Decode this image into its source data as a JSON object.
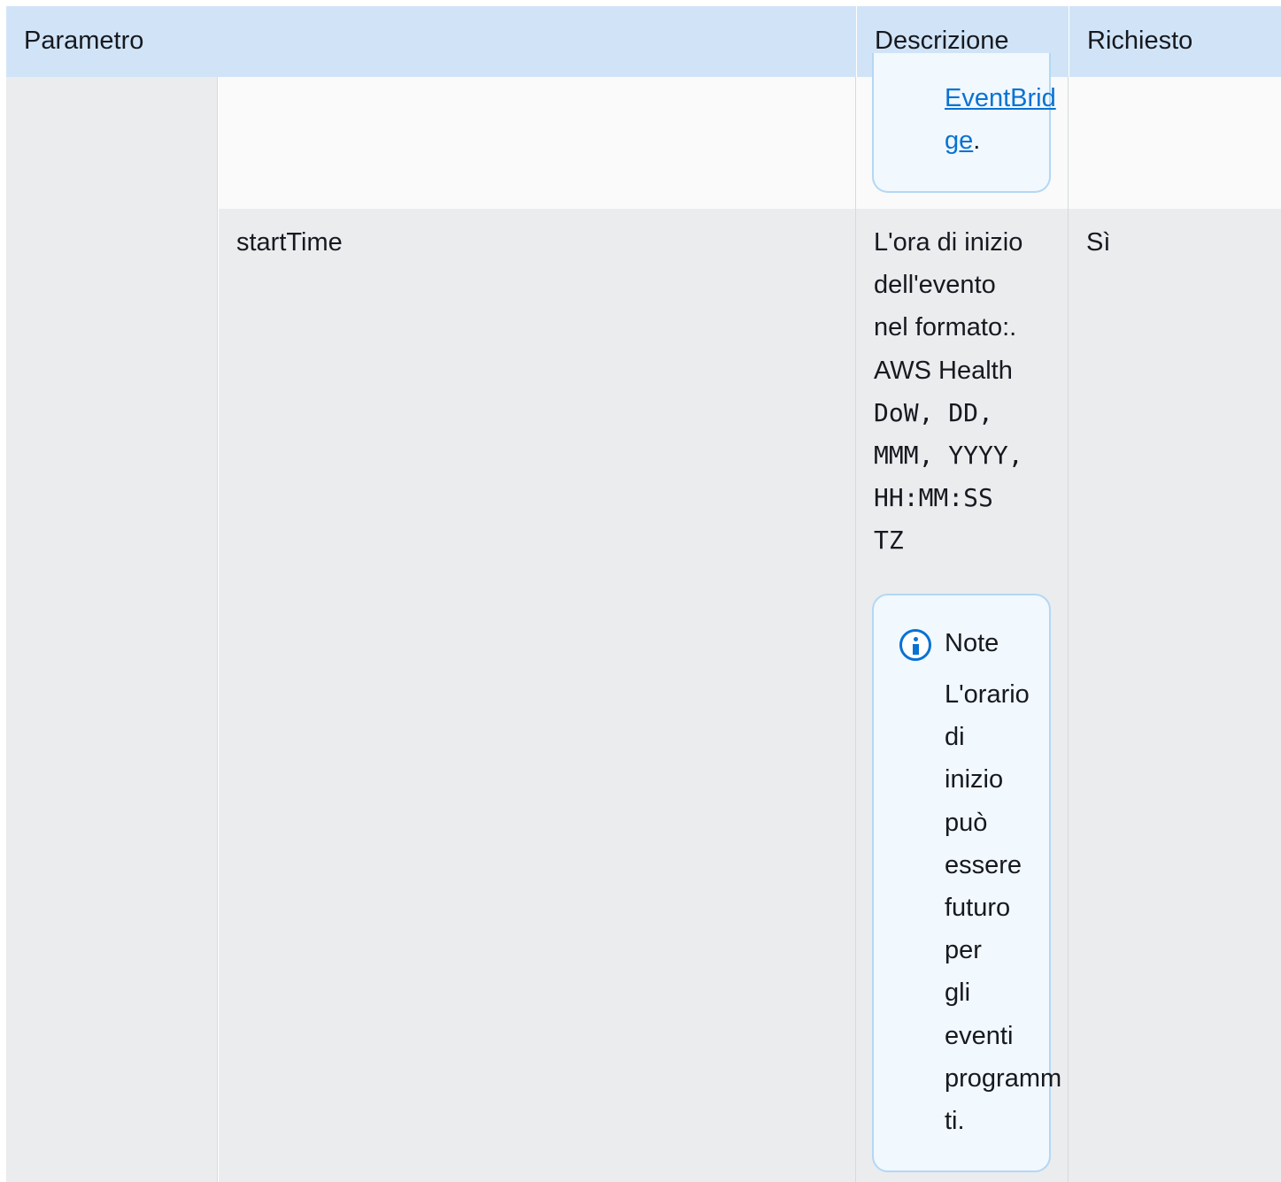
{
  "header": {
    "col_parameter": "Parametro",
    "col_description": "Descrizione",
    "col_required": "Richiesto"
  },
  "row_prev": {
    "note_link_line1": "EventBrid",
    "note_link_line2": "ge",
    "note_link_suffix": "."
  },
  "row_starttime": {
    "parameter": "startTime",
    "description_lines": [
      "L'ora di inizio",
      "dell'evento",
      "nel formato:.",
      "AWS Health"
    ],
    "format_lines": [
      "DoW, DD,",
      "MMM, YYYY,",
      "HH:MM:SS",
      "TZ"
    ],
    "required": "Sì",
    "note": {
      "title": "Note",
      "lines": [
        "L'orario",
        "di",
        "inizio",
        "può",
        "essere",
        "futuro",
        "per",
        "gli",
        "eventi",
        "programm",
        "ti."
      ]
    }
  },
  "icons": {
    "note": "info-icon"
  },
  "colors": {
    "header_bg": "#d1e4f7",
    "row_bg": "#ebecee",
    "row_alt_bg": "#fafafa",
    "note_border": "#b3d7f4",
    "note_bg": "#f1f8fe",
    "link": "#0972d3"
  }
}
